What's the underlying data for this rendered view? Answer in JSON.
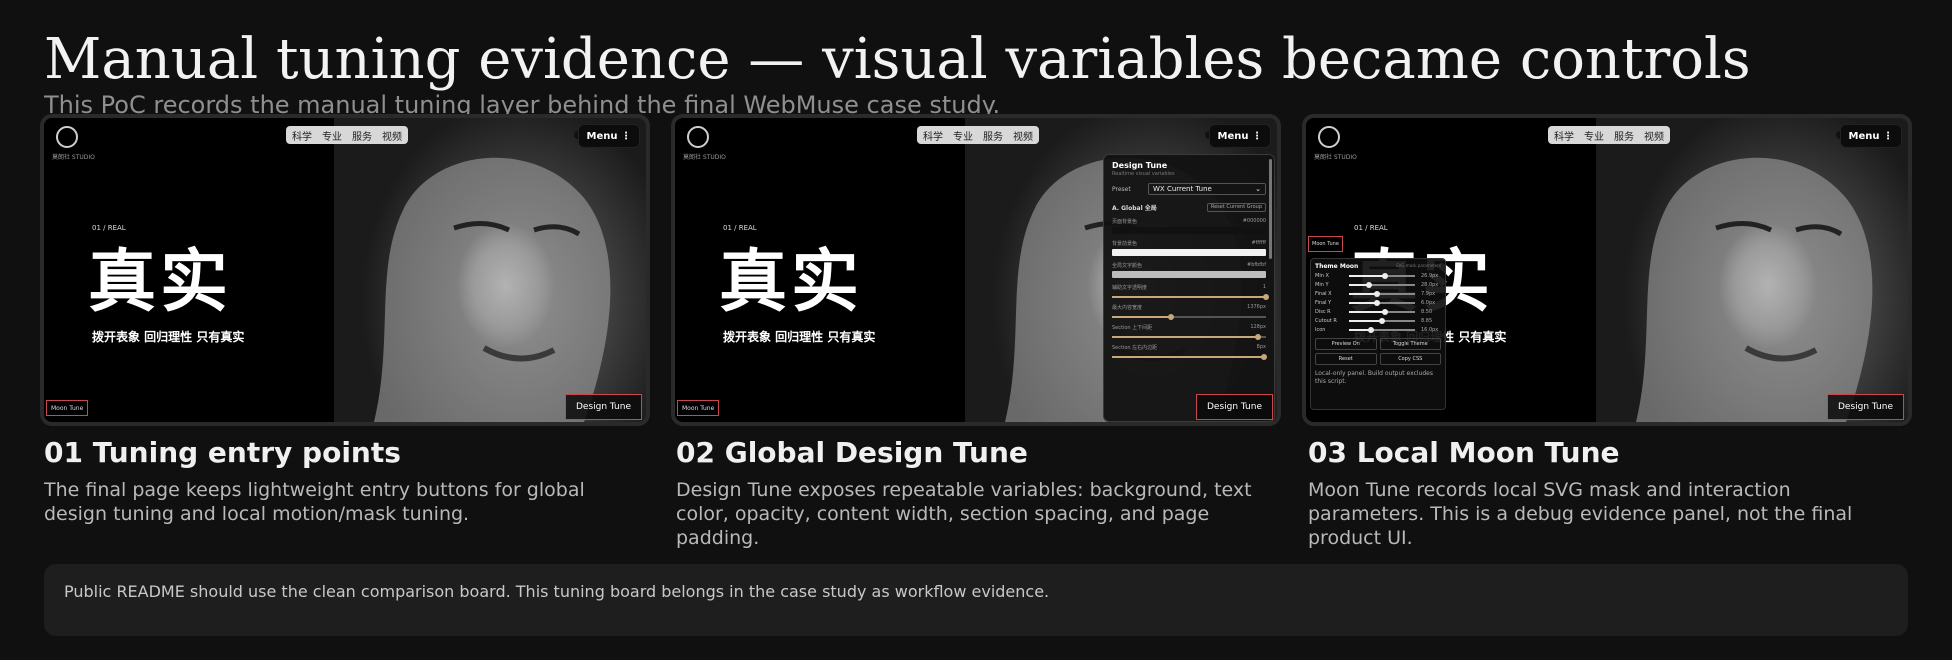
{
  "header": {
    "title": "Manual tuning evidence — visual variables became controls",
    "subtitle": "This PoC records the manual tuning layer behind the final WebMuse case study."
  },
  "mock_site": {
    "logo_text": "莫朗社 STUDIO",
    "nav_items": [
      "科学",
      "专业",
      "服务",
      "视频"
    ],
    "menu_label": "Menu ⋮",
    "tag": "01 / REAL",
    "hero": "真实",
    "hero_sub": "拨开表象  回归理性  只有真实",
    "moon_tune_label": "Moon Tune",
    "design_tune_label": "Design Tune"
  },
  "design_tune_panel": {
    "title": "Design Tune",
    "subtitle": "Realtime visual variables",
    "preset_label": "Preset",
    "preset_value": "WX Current Tune",
    "group": "A. Global 全局",
    "reset_group": "Reset Current Group",
    "fields": [
      {
        "label": "页面背景色",
        "value": "#000000",
        "color": "#111111"
      },
      {
        "label": "背景前景色",
        "value": "#ffffff",
        "color": "#f2f2f2"
      },
      {
        "label": "全局文字颜色",
        "value": "#bfbfbf",
        "color": "#bdbdbd"
      }
    ],
    "sliders": [
      {
        "label": "辅助文字透明度",
        "value": "1",
        "fraction": 1.0
      },
      {
        "label": "最大内容宽度",
        "value": "1376px",
        "fraction": 0.38
      },
      {
        "label": "Section 上下间距",
        "value": "128px",
        "fraction": 0.95
      },
      {
        "label": "Section 左右内边距",
        "value": "8px",
        "fraction": 0.99
      }
    ]
  },
  "moon_tune_panel": {
    "title": "Theme Moon",
    "subtitle": "SVG mask parameters",
    "rows": [
      {
        "name": "Min X",
        "value": "26.9px",
        "fraction": 0.55
      },
      {
        "name": "Min Y",
        "value": "28.0px",
        "fraction": 0.3
      },
      {
        "name": "Final X",
        "value": "7.9px",
        "fraction": 0.42
      },
      {
        "name": "Final Y",
        "value": "6.0px",
        "fraction": 0.42
      },
      {
        "name": "Disc R",
        "value": "8.50",
        "fraction": 0.55
      },
      {
        "name": "Cutout R",
        "value": "8.85",
        "fraction": 0.5
      },
      {
        "name": "Icon",
        "value": "16.0px",
        "fraction": 0.34
      }
    ],
    "buttons": [
      "Preview On",
      "Toggle Theme",
      "Reset",
      "Copy CSS"
    ],
    "note": "Local-only panel. Build output excludes this script."
  },
  "cards": [
    {
      "title": "01  Tuning entry points",
      "body": "The final page keeps lightweight entry buttons for global design tuning and local motion/mask tuning."
    },
    {
      "title": "02  Global Design Tune",
      "body": "Design Tune exposes repeatable variables: background, text color, opacity, content width, section spacing, and page padding."
    },
    {
      "title": "03  Local Moon Tune",
      "body": "Moon Tune records local SVG mask and interaction parameters. This is a debug evidence panel, not the final product UI."
    }
  ],
  "footer_note": "Public README should use the clean comparison board. This tuning board belongs in the case study as workflow evidence."
}
